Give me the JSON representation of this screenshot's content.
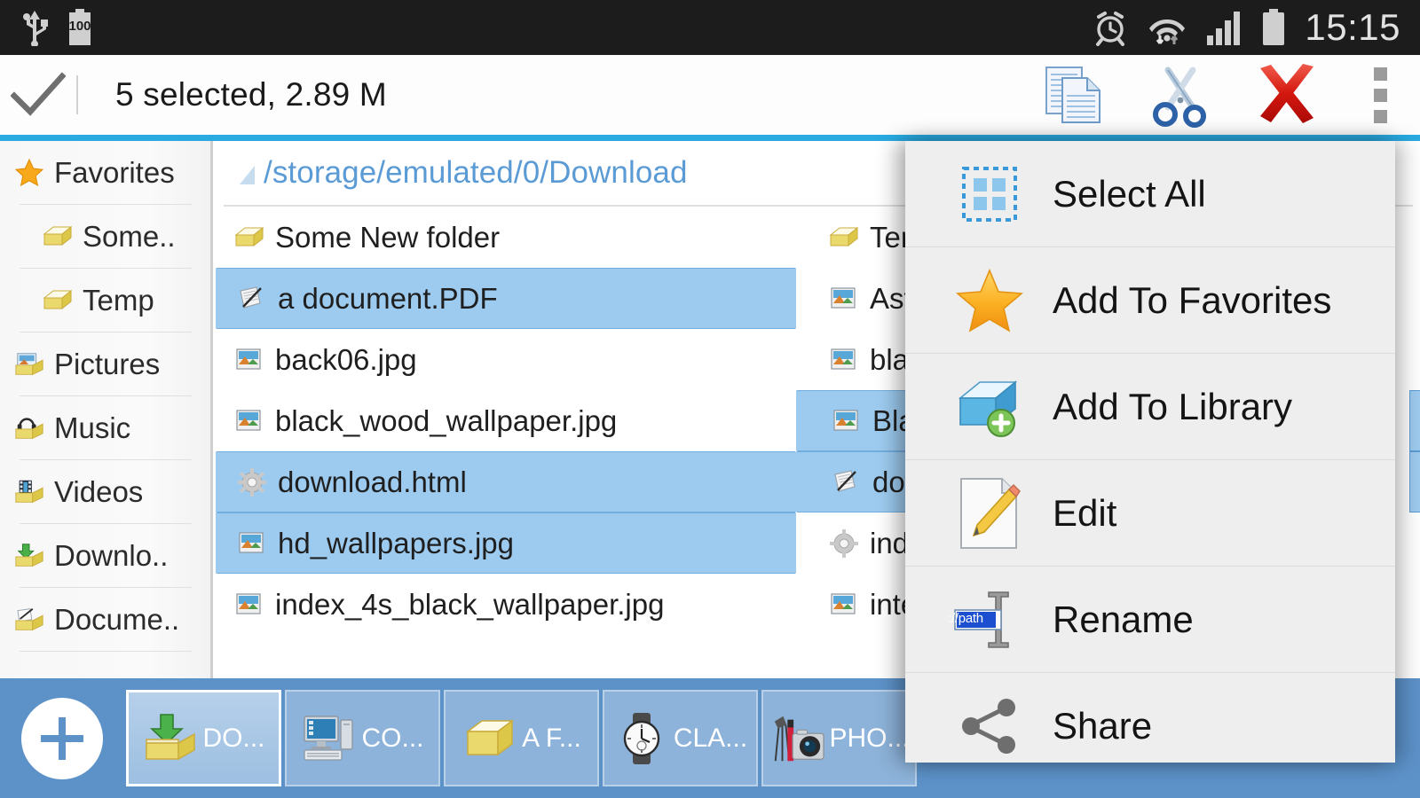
{
  "status_bar": {
    "time": "15:15",
    "left_icons": [
      "usb-icon",
      "battery-level-icon"
    ],
    "battery_level": "100",
    "right_icons": [
      "alarm-icon",
      "wifi-icon",
      "signal-icon",
      "battery-icon"
    ]
  },
  "action_bar": {
    "done_icon": "check-icon",
    "title": "5 selected, 2.89 M",
    "actions": [
      {
        "name": "copy-button",
        "icon": "copy-documents-icon"
      },
      {
        "name": "cut-button",
        "icon": "scissors-icon"
      },
      {
        "name": "delete-button",
        "icon": "red-x-icon"
      },
      {
        "name": "overflow-button",
        "icon": "three-dots-icon"
      }
    ]
  },
  "sidebar": {
    "items": [
      {
        "label": "Favorites",
        "icon": "star-icon",
        "level": 0
      },
      {
        "label": "Some..",
        "icon": "folder-icon",
        "level": 1
      },
      {
        "label": "Temp",
        "icon": "folder-icon",
        "level": 1
      },
      {
        "label": "Pictures",
        "icon": "pictures-folder-icon",
        "level": 0
      },
      {
        "label": "Music",
        "icon": "music-folder-icon",
        "level": 0
      },
      {
        "label": "Videos",
        "icon": "videos-folder-icon",
        "level": 0
      },
      {
        "label": "Downlo..",
        "icon": "downloads-folder-icon",
        "level": 0
      },
      {
        "label": "Docume..",
        "icon": "documents-folder-icon",
        "level": 0
      }
    ]
  },
  "file_pane": {
    "path": "/storage/emulated/0/Download",
    "path_icon": "sdcard-triangle-icon",
    "column1": [
      {
        "name": "Some New folder",
        "icon": "folder-icon",
        "selected": false
      },
      {
        "name": "a document.PDF",
        "icon": "document-icon",
        "selected": true
      },
      {
        "name": "back06.jpg",
        "icon": "image-icon",
        "selected": false
      },
      {
        "name": "black_wood_wallpaper.jpg",
        "icon": "image-icon",
        "selected": false
      },
      {
        "name": "download.html",
        "icon": "gear-icon",
        "selected": true
      },
      {
        "name": "hd_wallpapers.jpg",
        "icon": "image-icon",
        "selected": true
      },
      {
        "name": "index_4s_black_wallpaper.jpg",
        "icon": "image-icon",
        "selected": false
      }
    ],
    "column2": [
      {
        "name": "Ter",
        "icon": "folder-icon",
        "selected": false
      },
      {
        "name": "Ast",
        "icon": "image-icon",
        "selected": false
      },
      {
        "name": "bla",
        "icon": "image-icon",
        "selected": false
      },
      {
        "name": "Bla",
        "icon": "image-icon",
        "selected": true
      },
      {
        "name": "dow",
        "icon": "document-icon",
        "selected": true
      },
      {
        "name": "ind",
        "icon": "gear-icon",
        "selected": false
      },
      {
        "name": "inte",
        "icon": "image-icon",
        "selected": false
      }
    ],
    "column3_selected_rows": [
      false,
      false,
      false,
      true,
      true,
      false,
      false
    ]
  },
  "menu": {
    "items": [
      {
        "label": "Select All",
        "icon": "select-all-icon"
      },
      {
        "label": "Add To Favorites",
        "icon": "star-icon"
      },
      {
        "label": "Add To Library",
        "icon": "add-to-library-icon"
      },
      {
        "label": "Edit",
        "icon": "edit-pencil-icon"
      },
      {
        "label": "Rename",
        "icon": "rename-icon",
        "icon_text": "://path"
      },
      {
        "label": "Share",
        "icon": "share-icon"
      }
    ]
  },
  "tab_bar": {
    "add_tab_label": "+",
    "tabs": [
      {
        "label": "DO...",
        "icon": "downloads-folder-icon",
        "active": true
      },
      {
        "label": "CO...",
        "icon": "computer-icon",
        "active": false
      },
      {
        "label": "A F...",
        "icon": "folder-icon",
        "active": false
      },
      {
        "label": "CLA...",
        "icon": "watch-icon",
        "active": false
      },
      {
        "label": "PHO...",
        "icon": "camera-icon",
        "active": false
      }
    ]
  },
  "colors": {
    "accent": "#29abe2",
    "selection": "#9dcbef",
    "tabbar": "#5d92c9",
    "path_text": "#5b9bd5",
    "statusbar": "#1c1c1c"
  }
}
